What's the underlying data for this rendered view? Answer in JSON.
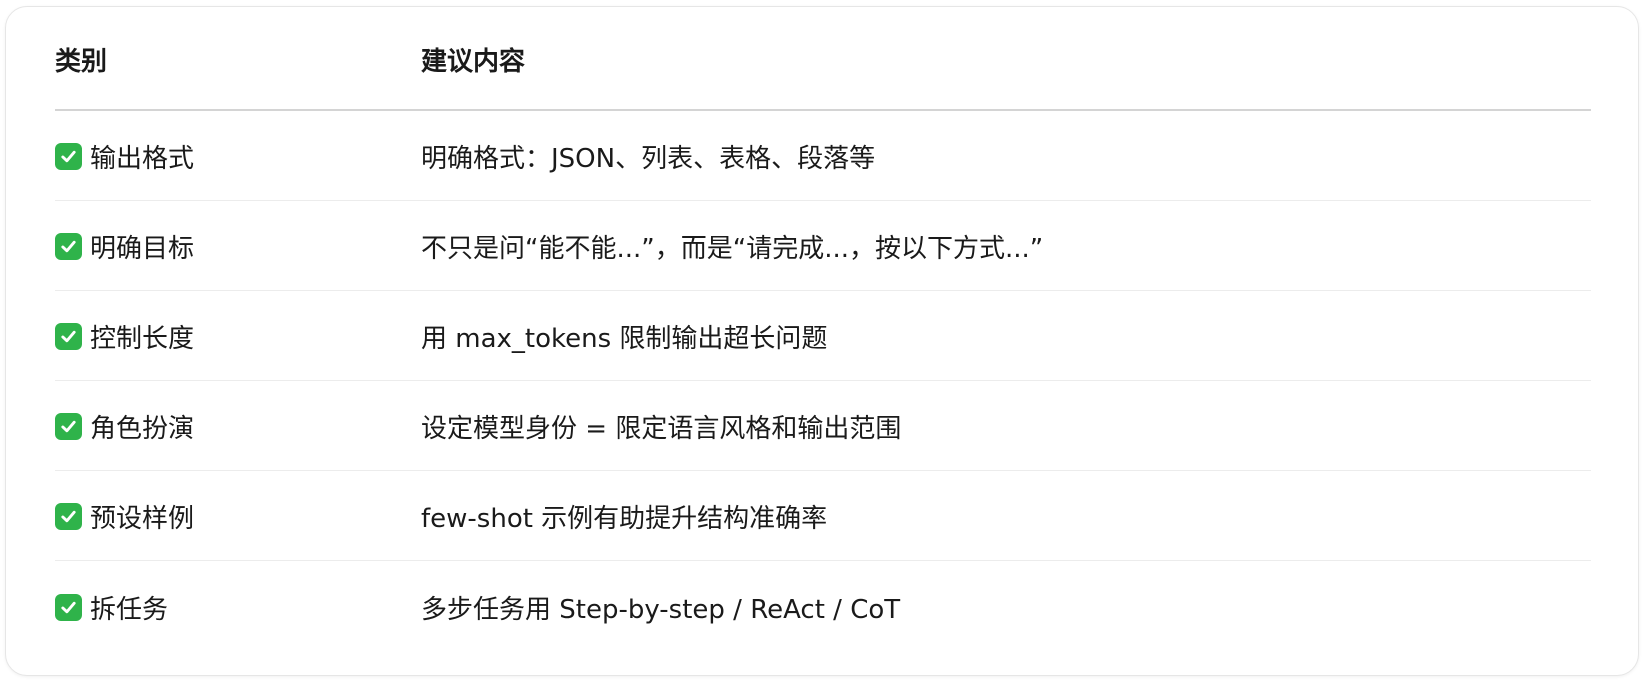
{
  "table": {
    "headers": {
      "category": "类别",
      "suggestion": "建议内容"
    },
    "rows": [
      {
        "icon": "check-mark-icon",
        "category": "输出格式",
        "suggestion": "明确格式：JSON、列表、表格、段落等"
      },
      {
        "icon": "check-mark-icon",
        "category": "明确目标",
        "suggestion": "不只是问“能不能...”，而是“请完成...，按以下方式...”"
      },
      {
        "icon": "check-mark-icon",
        "category": "控制长度",
        "suggestion": "用 max_tokens 限制输出超长问题"
      },
      {
        "icon": "check-mark-icon",
        "category": "角色扮演",
        "suggestion": "设定模型身份 = 限定语言风格和输出范围"
      },
      {
        "icon": "check-mark-icon",
        "category": "预设样例",
        "suggestion": "few-shot 示例有助提升结构准确率"
      },
      {
        "icon": "check-mark-icon",
        "category": "拆任务",
        "suggestion": "多步任务用 Step-by-step / ReAct / CoT"
      }
    ]
  },
  "colors": {
    "check_background": "#2fb34a",
    "header_divider": "#d4d4d4",
    "row_divider": "#ececec"
  }
}
